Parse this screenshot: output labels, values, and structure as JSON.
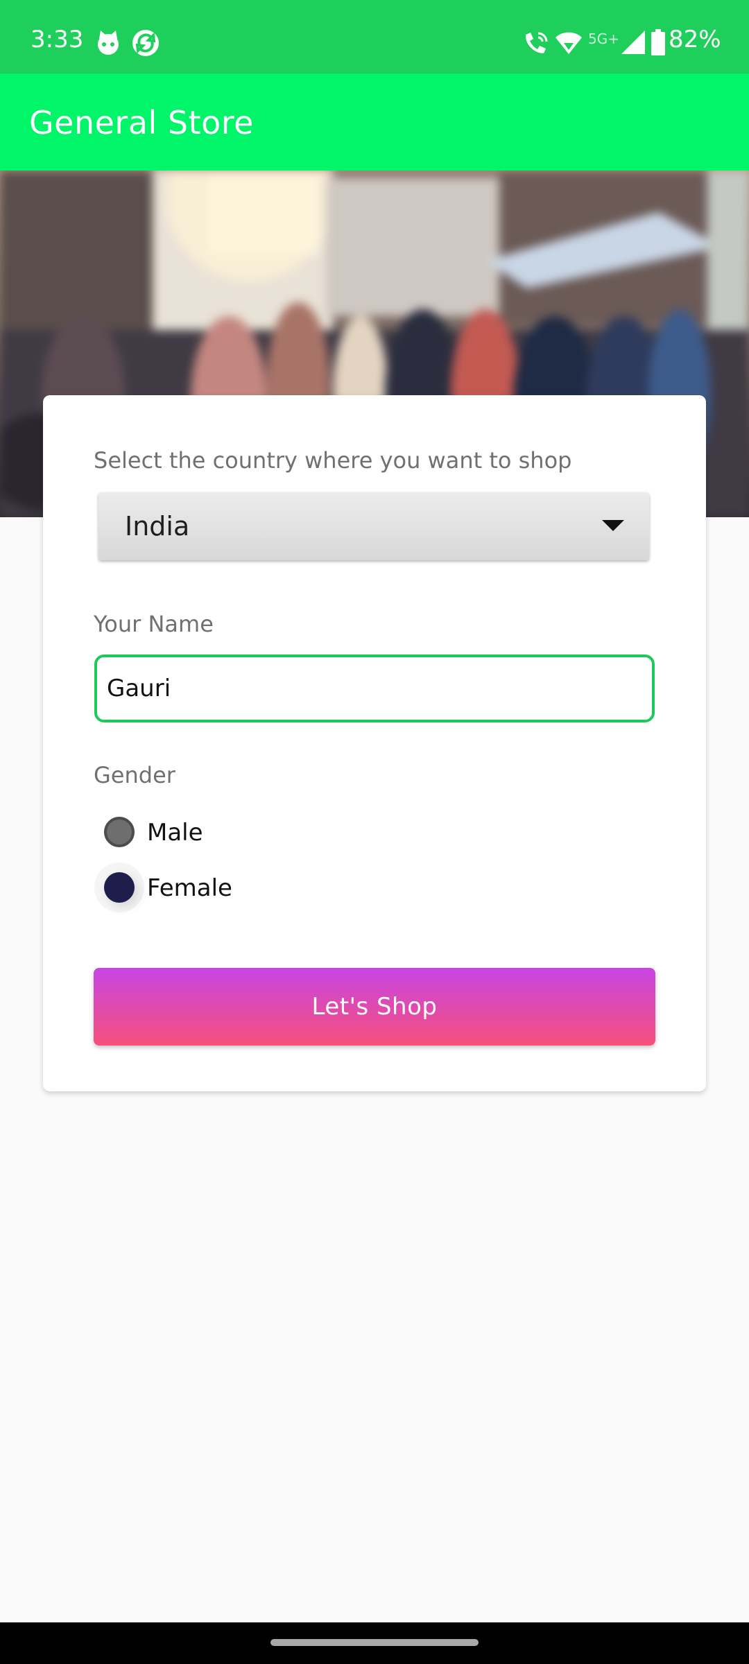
{
  "status_bar": {
    "time": "3:33",
    "network": "5G+",
    "battery": "82%",
    "left_icons": [
      "cat-face-icon",
      "sync-app-icon"
    ],
    "right_icons": [
      "wifi-calling-icon",
      "wifi-icon",
      "signal-icon",
      "battery-icon"
    ]
  },
  "app_bar": {
    "title": "General Store",
    "color": "#00f569"
  },
  "form": {
    "country_label": "Select the country where you want to shop",
    "country_selected": "India",
    "name_label": "Your Name",
    "name_value": "Gauri",
    "gender_label": "Gender",
    "gender_options": [
      {
        "label": "Male",
        "selected": false
      },
      {
        "label": "Female",
        "selected": true
      }
    ],
    "submit_label": "Let's  Shop"
  },
  "colors": {
    "status_bar": "#1ecf5b",
    "input_border": "#1ec95a",
    "button_gradient_top": "#c745e3",
    "button_gradient_bottom": "#f6507a",
    "radio_selected": "#1f1d4a"
  }
}
